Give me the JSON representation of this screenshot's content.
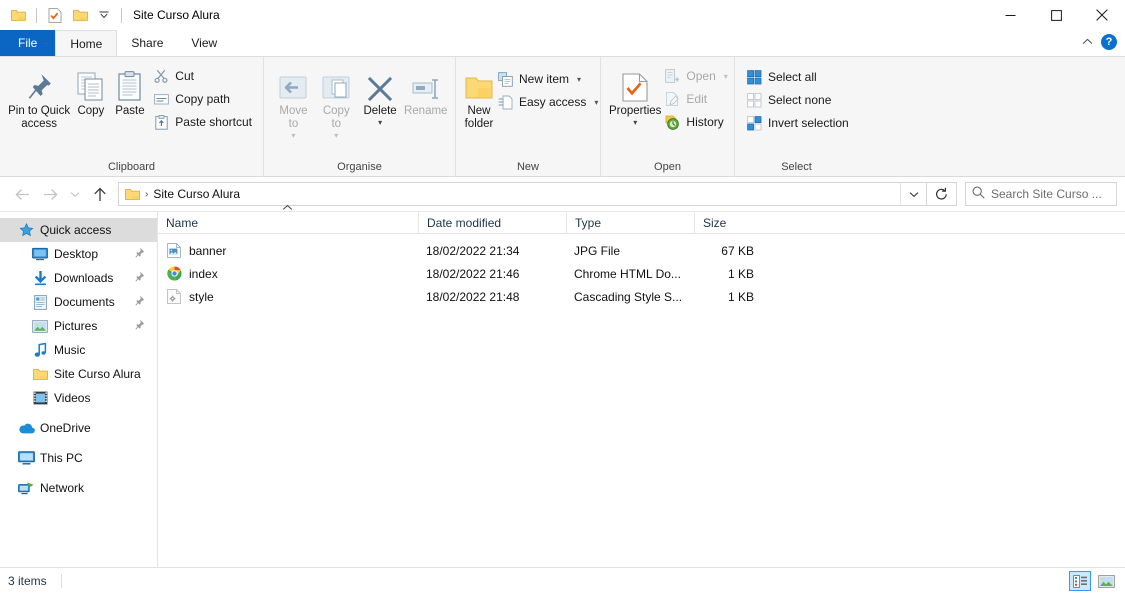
{
  "window": {
    "title": "Site Curso Alura",
    "quick_access_toolbar": [
      {
        "name": "folder-icon",
        "label": "Folder"
      },
      {
        "name": "properties-icon",
        "label": "Properties"
      },
      {
        "name": "new-folder-icon",
        "label": "New folder"
      },
      {
        "name": "chevron-down-icon",
        "label": "Customize Quick Access Toolbar"
      }
    ],
    "controls": {
      "minimize": "Minimize",
      "maximize": "Maximize",
      "close": "Close"
    }
  },
  "tabs": [
    {
      "label": "File",
      "id": "file"
    },
    {
      "label": "Home",
      "id": "home"
    },
    {
      "label": "Share",
      "id": "share"
    },
    {
      "label": "View",
      "id": "view"
    }
  ],
  "tab_right": {
    "collapse_label": "Collapse the Ribbon",
    "help_label": "?"
  },
  "ribbon": {
    "groups": [
      {
        "label": "Clipboard",
        "big_buttons": [
          {
            "label": "Pin to Quick\naccess",
            "icon": "pin-icon",
            "dim": false
          },
          {
            "label": "Copy",
            "icon": "copy-icon",
            "dim": false
          },
          {
            "label": "Paste",
            "icon": "paste-icon",
            "dim": false
          }
        ],
        "small_buttons": [
          {
            "label": "Cut",
            "icon": "cut-icon",
            "dim": false
          },
          {
            "label": "Copy path",
            "icon": "copy-path-icon",
            "dim": false
          },
          {
            "label": "Paste shortcut",
            "icon": "paste-shortcut-icon",
            "dim": false
          }
        ]
      },
      {
        "label": "Organise",
        "big_buttons": [
          {
            "label": "Move\nto",
            "icon": "move-to-icon",
            "dim": true,
            "caret": true
          },
          {
            "label": "Copy\nto",
            "icon": "copy-to-icon",
            "dim": true,
            "caret": true
          },
          {
            "label": "Delete",
            "icon": "delete-icon",
            "dim": false,
            "caret": true
          },
          {
            "label": "Rename",
            "icon": "rename-icon",
            "dim": true
          }
        ],
        "small_buttons": []
      },
      {
        "label": "New",
        "big_buttons": [
          {
            "label": "New\nfolder",
            "icon": "new-folder-icon",
            "dim": false
          }
        ],
        "small_buttons": [
          {
            "label": "New item",
            "icon": "new-item-icon",
            "dim": false,
            "caret": true
          },
          {
            "label": "Easy access",
            "icon": "easy-access-icon",
            "dim": true,
            "caret": true
          }
        ]
      },
      {
        "label": "Open",
        "big_buttons": [
          {
            "label": "Properties",
            "icon": "properties-icon",
            "dim": false,
            "caret": true
          }
        ],
        "small_buttons": [
          {
            "label": "Open",
            "icon": "open-icon",
            "dim": true,
            "caret": true
          },
          {
            "label": "Edit",
            "icon": "edit-icon",
            "dim": true
          },
          {
            "label": "History",
            "icon": "history-icon",
            "dim": false
          }
        ]
      },
      {
        "label": "Select",
        "big_buttons": [],
        "small_buttons": [
          {
            "label": "Select all",
            "icon": "select-all-icon",
            "dim": false
          },
          {
            "label": "Select none",
            "icon": "select-none-icon",
            "dim": false
          },
          {
            "label": "Invert selection",
            "icon": "invert-selection-icon",
            "dim": false
          }
        ]
      }
    ]
  },
  "navbar": {
    "back": "Back",
    "forward": "Forward",
    "recent": "Recent locations",
    "up": "Up",
    "breadcrumb": {
      "icon": "folder-icon",
      "separator": "›",
      "path": "Site Curso Alura"
    },
    "history_dropdown": "Previous locations",
    "refresh": "Refresh",
    "search": {
      "icon": "search-icon",
      "placeholder": "Search Site Curso ..."
    }
  },
  "sidebar": {
    "items": [
      {
        "label": "Quick access",
        "icon": "star-icon",
        "selected": true,
        "indent": false,
        "pinned": false
      },
      {
        "label": "Desktop",
        "icon": "desktop-icon",
        "selected": false,
        "indent": true,
        "pinned": true
      },
      {
        "label": "Downloads",
        "icon": "downloads-icon",
        "selected": false,
        "indent": true,
        "pinned": true
      },
      {
        "label": "Documents",
        "icon": "documents-icon",
        "selected": false,
        "indent": true,
        "pinned": true
      },
      {
        "label": "Pictures",
        "icon": "pictures-icon",
        "selected": false,
        "indent": true,
        "pinned": true
      },
      {
        "label": "Music",
        "icon": "music-icon",
        "selected": false,
        "indent": true,
        "pinned": false
      },
      {
        "label": "Site Curso Alura",
        "icon": "folder-icon",
        "selected": false,
        "indent": true,
        "pinned": false
      },
      {
        "label": "Videos",
        "icon": "videos-icon",
        "selected": false,
        "indent": true,
        "pinned": false
      },
      {
        "label": "OneDrive",
        "icon": "onedrive-icon",
        "selected": false,
        "indent": false,
        "pinned": false,
        "gap_before": true
      },
      {
        "label": "This PC",
        "icon": "this-pc-icon",
        "selected": false,
        "indent": false,
        "pinned": false,
        "gap_before": true
      },
      {
        "label": "Network",
        "icon": "network-icon",
        "selected": false,
        "indent": false,
        "pinned": false,
        "gap_before": true
      }
    ]
  },
  "file_list": {
    "columns": [
      {
        "label": "Name",
        "key": "name",
        "sorted": "asc"
      },
      {
        "label": "Date modified",
        "key": "date"
      },
      {
        "label": "Type",
        "key": "type"
      },
      {
        "label": "Size",
        "key": "size"
      }
    ],
    "sort_indicator": "⌃",
    "rows": [
      {
        "name": "banner",
        "date": "18/02/2022 21:34",
        "type": "JPG File",
        "size": "67 KB",
        "icon": "image-file-icon"
      },
      {
        "name": "index",
        "date": "18/02/2022 21:46",
        "type": "Chrome HTML Do...",
        "size": "1 KB",
        "icon": "chrome-file-icon"
      },
      {
        "name": "style",
        "date": "18/02/2022 21:48",
        "type": "Cascading Style S...",
        "size": "1 KB",
        "icon": "css-file-icon"
      }
    ]
  },
  "statusbar": {
    "item_count": "3 items",
    "view_buttons": [
      {
        "name": "details-view-button",
        "label": "Details view",
        "selected": true
      },
      {
        "name": "large-icons-view-button",
        "label": "Large icons view",
        "selected": false
      }
    ]
  },
  "colors": {
    "accent": "#0b66c3",
    "ribbon_bg": "#f6f6f6",
    "selection": "#dcdcdc",
    "view_selected": "#cce8ff",
    "header_text": "#21374d"
  }
}
